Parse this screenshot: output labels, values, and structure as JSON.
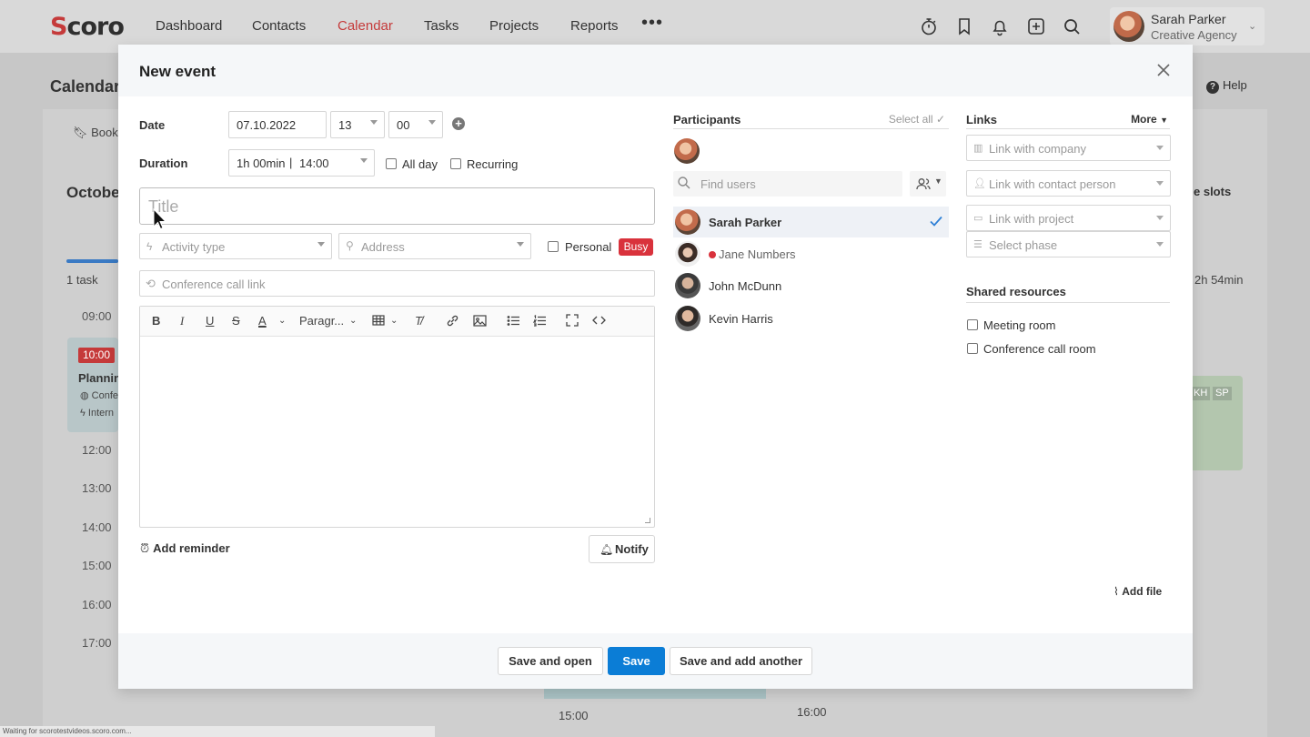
{
  "nav": {
    "logo_prefix": "S",
    "logo_rest": "coro",
    "items": [
      "Dashboard",
      "Contacts",
      "Calendar",
      "Tasks",
      "Projects",
      "Reports"
    ],
    "active": "Calendar",
    "more": "•••",
    "user": {
      "name": "Sarah Parker",
      "org": "Creative Agency"
    },
    "icons": [
      "timer-icon",
      "bookmark-icon",
      "bell-icon",
      "plus-square-icon",
      "search-icon"
    ]
  },
  "background": {
    "title": "Calendar",
    "help": "Help",
    "bookmark": "Bookm",
    "month": "Octobe",
    "task_count": "1 task",
    "slots": "e slots",
    "duration": "2h 54min",
    "times": [
      "09:00",
      "12:00",
      "13:00",
      "14:00",
      "15:00",
      "16:00",
      "17:00"
    ],
    "event_time": "10:00",
    "event_title": "Plannin",
    "event_line1": "Confe",
    "event_line2": "Intern",
    "tags": [
      "KH",
      "SP"
    ],
    "bottom_times": [
      "15:00",
      "16:00"
    ],
    "status": "Waiting for scorotestvideos.scoro.com..."
  },
  "modal": {
    "title": "New event",
    "date_label": "Date",
    "date": "07.10.2022",
    "hour": "13",
    "minute": "00",
    "duration_label": "Duration",
    "duration": "1h 00min",
    "end_time": "14:00",
    "all_day": "All day",
    "recurring": "Recurring",
    "title_placeholder": "Title",
    "activity_placeholder": "Activity type",
    "address_placeholder": "Address",
    "personal": "Personal",
    "busy": "Busy",
    "conference_placeholder": "Conference call link",
    "paragraph": "Paragr...",
    "add_reminder": "Add reminder",
    "notify": "Notify",
    "participants": {
      "heading": "Participants",
      "select_all": "Select all",
      "find_placeholder": "Find users",
      "list": [
        {
          "name": "Sarah Parker",
          "selected": true
        },
        {
          "name": "Jane Numbers",
          "selected": false
        },
        {
          "name": "John McDunn",
          "selected": false
        },
        {
          "name": "Kevin Harris",
          "selected": false
        }
      ]
    },
    "links": {
      "heading": "Links",
      "more": "More",
      "company": "Link with company",
      "contact": "Link with contact person",
      "project": "Link with project",
      "phase": "Select phase"
    },
    "shared": {
      "heading": "Shared resources",
      "meeting_room": "Meeting room",
      "conference_room": "Conference call room"
    },
    "add_file": "Add file",
    "buttons": {
      "save_open": "Save and open",
      "save": "Save",
      "save_another": "Save and add another"
    }
  },
  "colors": {
    "accent": "#c53a3a",
    "primary": "#0b7dd6",
    "busy": "#d9323c"
  }
}
